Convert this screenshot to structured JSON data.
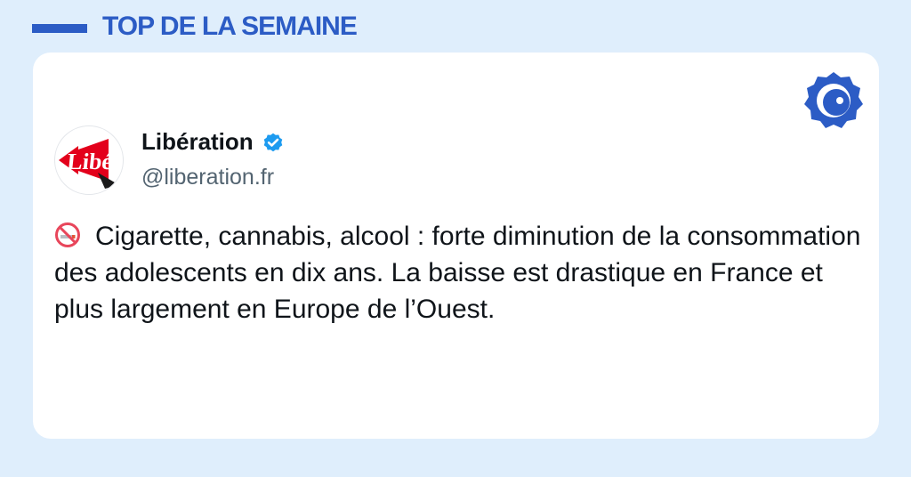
{
  "header": {
    "title": "TOP DE LA SEMAINE"
  },
  "tweet": {
    "account": {
      "name": "Libération",
      "handle": "@liberation.fr",
      "avatar_text": "Libé",
      "verified": true
    },
    "emoji_icon": "no-smoking-icon",
    "text": "Cigarette, cannabis, alcool : forte diminution de la consommation des adolescents en dix ans. La baisse est drastique en France et plus largement en Europe de l’Ouest."
  },
  "brand_icon": "brand-logo-icon",
  "colors": {
    "background": "#dfeefc",
    "accent": "#2c5cc5",
    "verified": "#1d9bf0",
    "liberation_red": "#e3001b"
  }
}
